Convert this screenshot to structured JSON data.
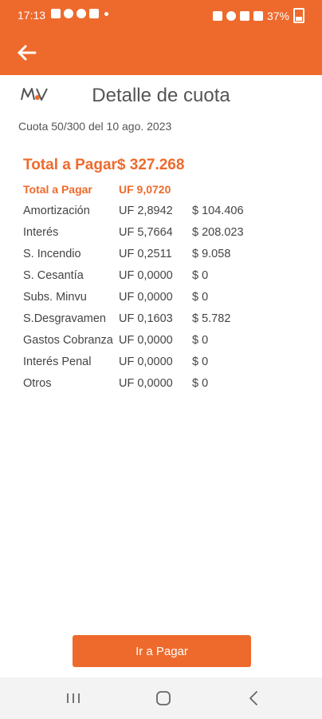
{
  "status_bar": {
    "time": "17:13",
    "battery": "37%"
  },
  "header": {
    "title": "Detalle de cuota",
    "subtitle": "Cuota 50/300 del 10 ago. 2023"
  },
  "summary": {
    "total_label": "Total a Pagar",
    "total_amount": "$ 327.268"
  },
  "rows": [
    {
      "label": "Total a Pagar",
      "uf": "UF 9,0720",
      "clp": ""
    },
    {
      "label": "Amortización",
      "uf": "UF 2,8942",
      "clp": "$ 104.406"
    },
    {
      "label": "Interés",
      "uf": "UF 5,7664",
      "clp": "$ 208.023"
    },
    {
      "label": "S. Incendio",
      "uf": "UF 0,2511",
      "clp": "$ 9.058"
    },
    {
      "label": "S. Cesantía",
      "uf": "UF 0,0000",
      "clp": "$ 0"
    },
    {
      "label": "Subs. Minvu",
      "uf": "UF 0,0000",
      "clp": "$ 0"
    },
    {
      "label": "S.Desgravamen",
      "uf": "UF 0,1603",
      "clp": "$ 5.782"
    },
    {
      "label": "Gastos Cobranza",
      "uf": "UF 0,0000",
      "clp": "$ 0"
    },
    {
      "label": "Interés Penal",
      "uf": "UF 0,0000",
      "clp": "$ 0"
    },
    {
      "label": "Otros",
      "uf": "UF 0,0000",
      "clp": "$ 0"
    }
  ],
  "actions": {
    "pay_label": "Ir a Pagar"
  },
  "colors": {
    "accent": "#ee6a2c"
  },
  "icons": {
    "back": "arrow-left-icon",
    "logo": "mv-logo"
  }
}
